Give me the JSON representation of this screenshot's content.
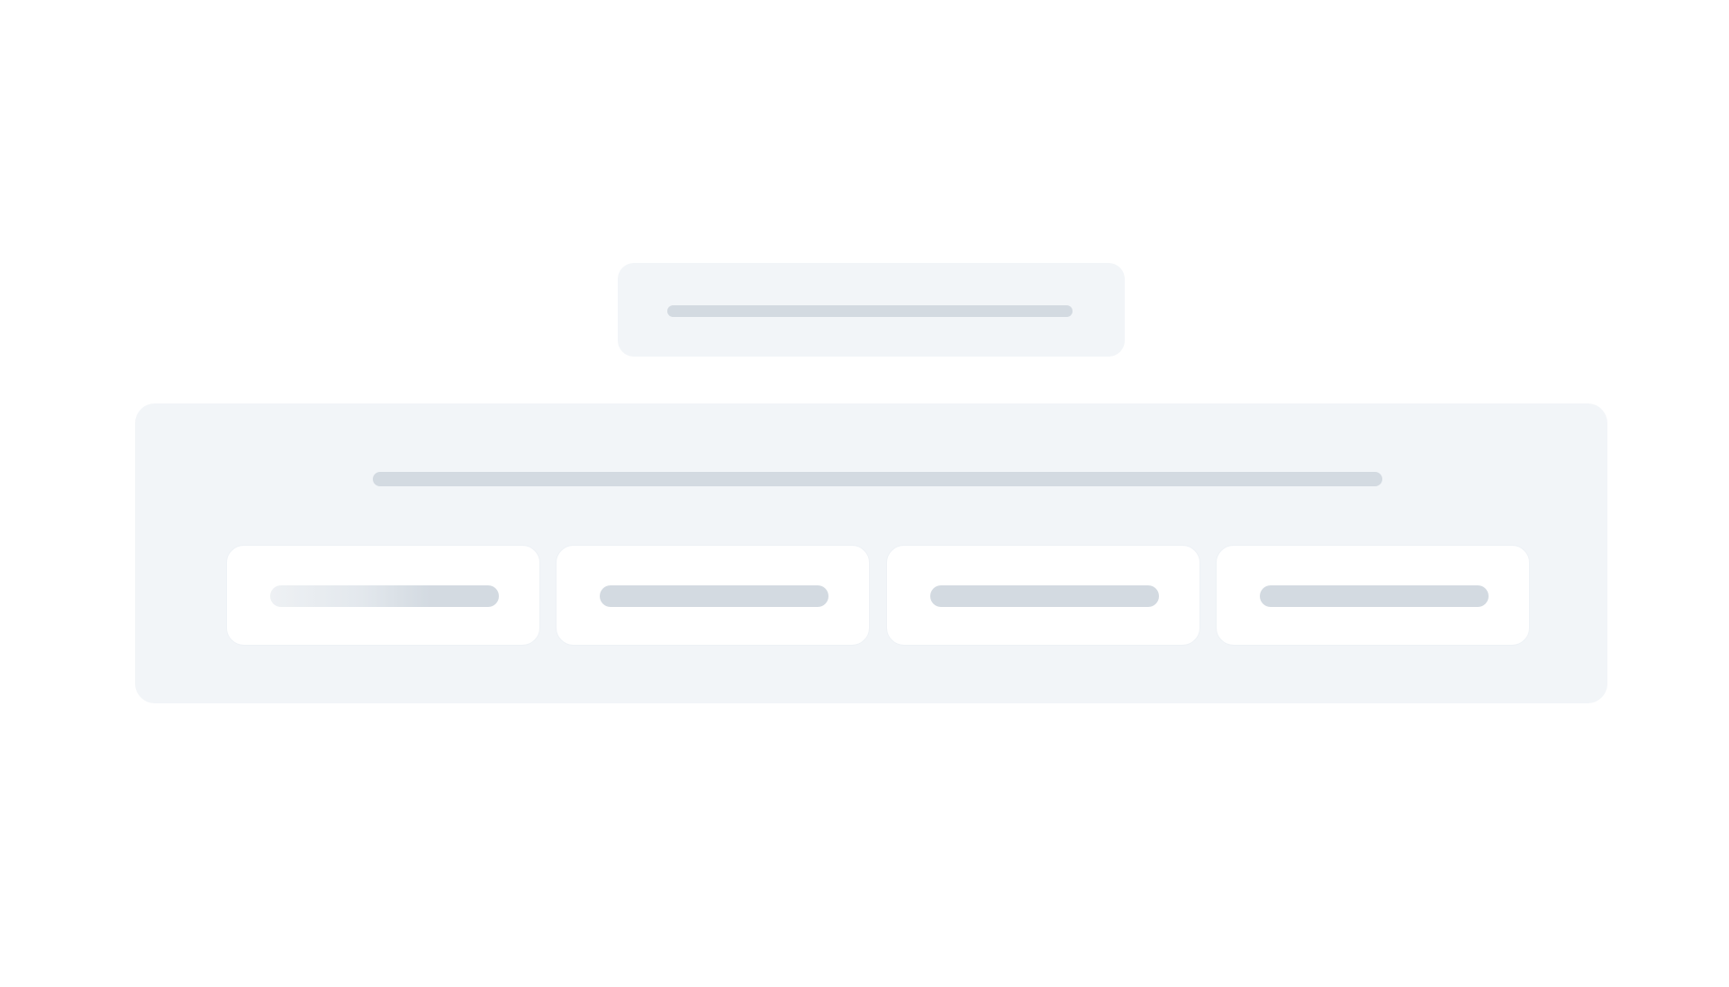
{
  "screen": {
    "state": "loading-skeleton",
    "colors": {
      "background": "#ffffff",
      "panel": "#f2f5f8",
      "placeholder": "#d3dae1",
      "card": "#ffffff"
    }
  },
  "header_skeleton": {
    "text": ""
  },
  "main_panel_skeleton": {
    "text": "",
    "cards": [
      {
        "text": ""
      },
      {
        "text": ""
      },
      {
        "text": ""
      },
      {
        "text": ""
      }
    ]
  }
}
